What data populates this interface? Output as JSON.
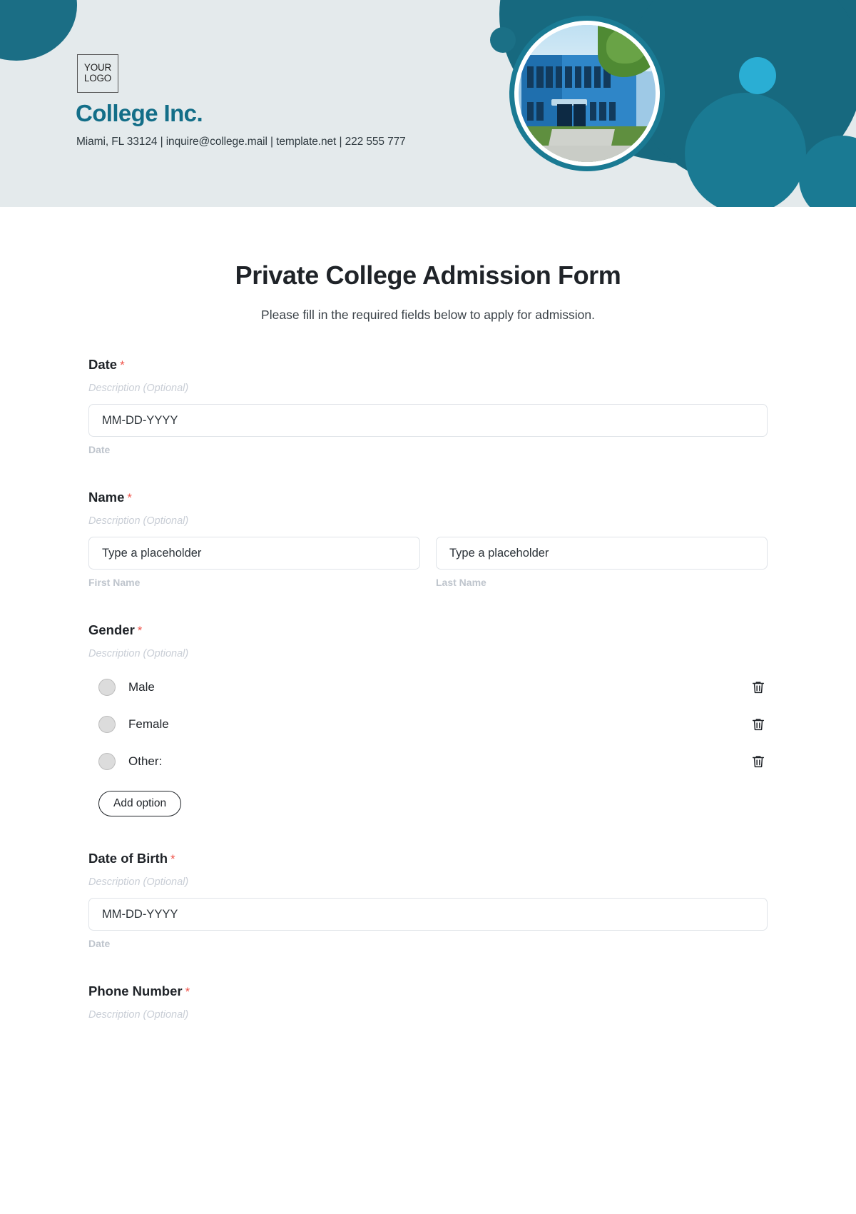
{
  "header": {
    "logo": {
      "line1": "YOUR",
      "line2": "LOGO"
    },
    "brand_name": "College Inc.",
    "contact": "Miami, FL 33124 | inquire@college.mail | template.net | 222 555 777",
    "accent_color": "#136e88",
    "background_color": "#e4eaec",
    "portrait_alt": "college-building-photo"
  },
  "form": {
    "title": "Private College Admission Form",
    "subtitle": "Please fill in the required fields below to apply for admission.",
    "required_marker": "*",
    "description_placeholder": "Description (Optional)",
    "fields": [
      {
        "label": "Date",
        "required": true,
        "description": "Description (Optional)",
        "input_value": "MM-DD-YYYY",
        "sub_label": "Date"
      },
      {
        "label": "Name",
        "required": true,
        "description": "Description (Optional)",
        "first": {
          "input_value": "Type a placeholder",
          "sub_label": "First Name"
        },
        "last": {
          "input_value": "Type a placeholder",
          "sub_label": "Last Name"
        }
      },
      {
        "label": "Gender",
        "required": true,
        "description": "Description (Optional)",
        "options": [
          "Male",
          "Female",
          "Other:"
        ],
        "add_option_label": "Add option",
        "delete_icon": "trash-icon"
      },
      {
        "label": "Date of Birth",
        "required": true,
        "description": "Description (Optional)",
        "input_value": "MM-DD-YYYY",
        "sub_label": "Date"
      },
      {
        "label": "Phone Number",
        "required": true,
        "description": "Description (Optional)"
      }
    ]
  }
}
